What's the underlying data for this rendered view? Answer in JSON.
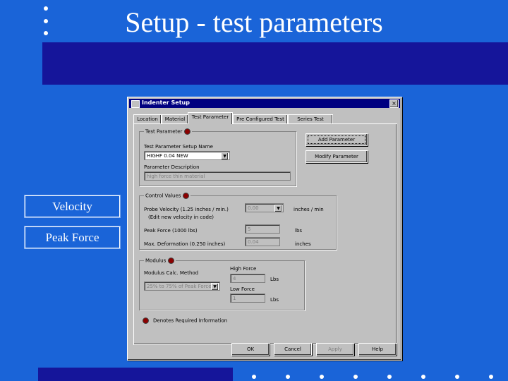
{
  "slide": {
    "title": "Setup - test parameters",
    "side_items": [
      "Velocity",
      "Peak Force"
    ]
  },
  "dialog": {
    "title": "Indenter Setup",
    "close_glyph": "×",
    "tabs": [
      "Location",
      "Material",
      "Test Parameter",
      "Pre Configured Test",
      "Series Test"
    ],
    "test_parameter": {
      "group_label": "Test Parameter",
      "setup_name_label": "Test Parameter Setup Name",
      "setup_name_value": "HIGHF 0.04 NEW",
      "description_label": "Parameter Description",
      "description_value": "high force thin material",
      "add_button": "Add Parameter",
      "modify_button": "Modify Parameter"
    },
    "control_values": {
      "group_label": "Control Values",
      "velocity_label": "Probe Velocity (1.25 inches / min.)",
      "velocity_note": "(Edit new velocity in code)",
      "velocity_value": "0.00",
      "velocity_unit": "inches / min",
      "peak_force_label": "Peak Force (1000 lbs)",
      "peak_force_value": "5",
      "peak_force_unit": "lbs",
      "deformation_label": "Max. Deformation (0.250 inches)",
      "deformation_value": "0.04",
      "deformation_unit": "inches"
    },
    "modulus": {
      "group_label": "Modulus",
      "method_label": "Modulus Calc. Method",
      "method_value": "25% to 75% of Peak Force",
      "high_force_label": "High Force",
      "high_force_value": "4",
      "high_force_unit": "Lbs",
      "low_force_label": "Low Force",
      "low_force_value": "1",
      "low_force_unit": "Lbs"
    },
    "legend": "Denotes Required Information",
    "buttons": [
      "OK",
      "Cancel",
      "Apply",
      "Help"
    ]
  }
}
